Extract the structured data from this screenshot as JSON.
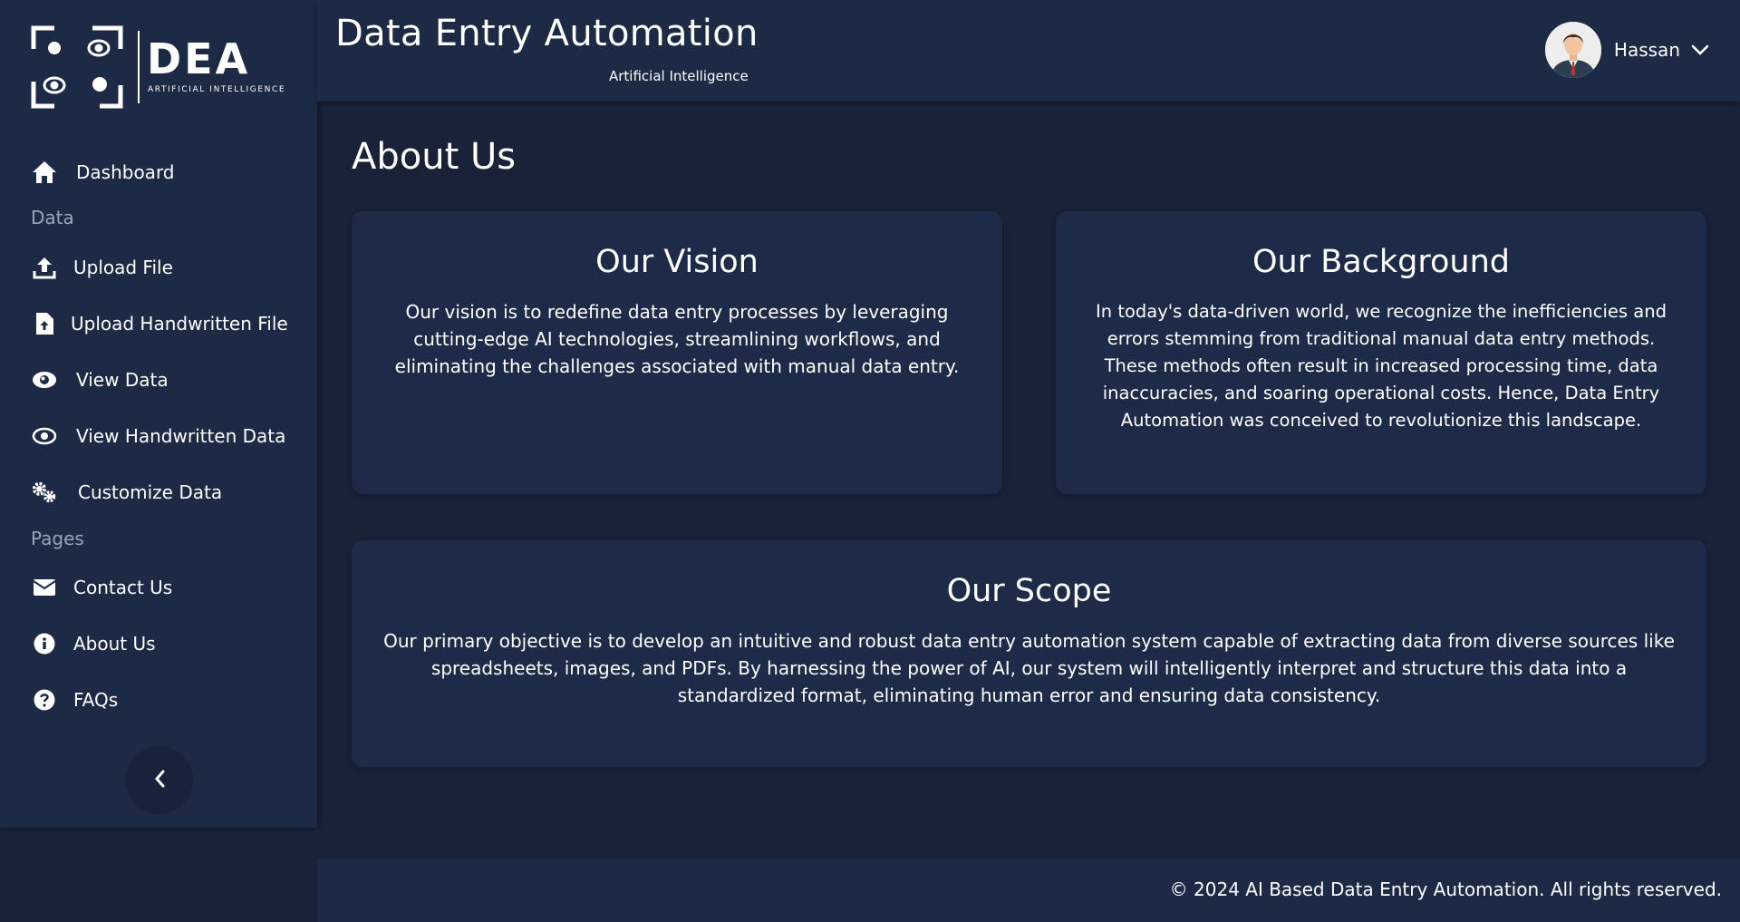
{
  "brand": {
    "logo_text": "DEA",
    "logo_tagline": "ARTIFICIAL INTELLIGENCE"
  },
  "header": {
    "title": "Data Entry Automation",
    "subtitle": "Artificial Intelligence",
    "user_name": "Hassan"
  },
  "sidebar": {
    "dashboard": "Dashboard",
    "section_data": "Data",
    "upload_file": "Upload File",
    "upload_handwritten_file": "Upload Handwritten File",
    "view_data": "View Data",
    "view_handwritten_data": "View Handwritten Data",
    "customize_data": "Customize Data",
    "section_pages": "Pages",
    "contact_us": "Contact Us",
    "about_us": "About Us",
    "faqs": "FAQs"
  },
  "main": {
    "page_title": "About Us",
    "vision": {
      "title": "Our Vision",
      "text": "Our vision is to redefine data entry processes by leveraging cutting-edge AI technologies, streamlining workflows, and eliminating the challenges associated with manual data entry."
    },
    "background": {
      "title": "Our Background",
      "text": "In today's data-driven world, we recognize the inefficiencies and errors stemming from traditional manual data entry methods. These methods often result in increased processing time, data inaccuracies, and soaring operational costs. Hence, Data Entry Automation was conceived to revolutionize this landscape."
    },
    "scope": {
      "title": "Our Scope",
      "text": "Our primary objective is to develop an intuitive and robust data entry automation system capable of extracting data from diverse sources like spreadsheets, images, and PDFs. By harnessing the power of AI, our system will intelligently interpret and structure this data into a standardized format, eliminating human error and ensuring data consistency."
    }
  },
  "footer": {
    "copyright": "© 2024 AI Based Data Entry Automation. All rights reserved."
  },
  "colors": {
    "background": "#1a2238",
    "panel": "#1d2a45",
    "card": "#1e2b48",
    "muted_text": "#9aa4b8",
    "text": "#ffffff"
  }
}
